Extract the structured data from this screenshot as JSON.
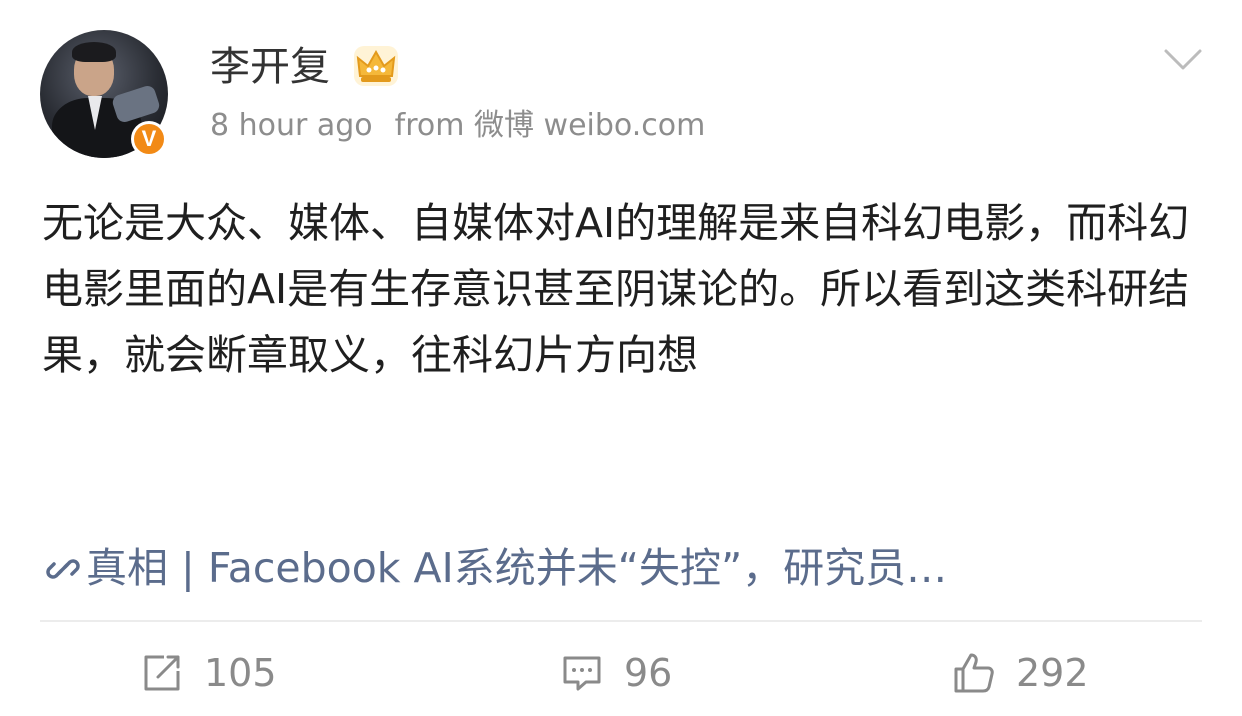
{
  "post": {
    "author": "李开复",
    "verified_badge": "V",
    "time": "8 hour ago",
    "source": "from 微博 weibo.com",
    "text": "无论是大众、媒体、自媒体对AI的理解是来自科幻电影，而科幻电影里面的AI是有生存意识甚至阴谋论的。所以看到这类科研结果，就会断章取义，往科幻片方向想",
    "link_text": "真相 | Facebook AI系统并未“失控”，研究员…",
    "link_icon": "link-icon",
    "member_icon": "crown-icon"
  },
  "actions": {
    "repost_count": "105",
    "comment_count": "96",
    "like_count": "292"
  },
  "colors": {
    "text": "#1f1f1f",
    "meta": "#8d8d8d",
    "link": "#5b6c8c",
    "badge": "#f28a16",
    "crown": "#f5b83a"
  }
}
